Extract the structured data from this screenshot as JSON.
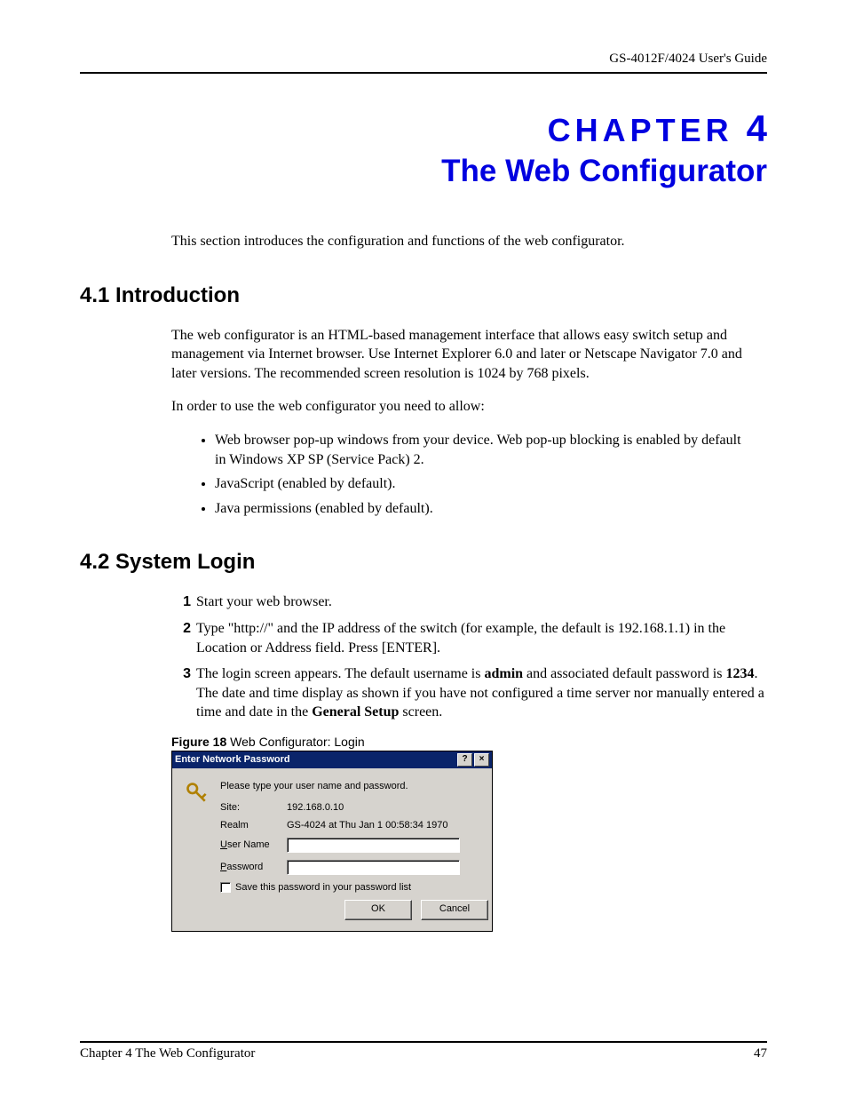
{
  "header": {
    "guide": "GS-4012F/4024 User's Guide"
  },
  "chapter": {
    "label": "CHAPTER",
    "number": "4",
    "title": "The Web Configurator",
    "intro": "This section introduces the configuration and functions of the web configurator."
  },
  "section1": {
    "heading": "4.1  Introduction",
    "para1": "The web configurator is an HTML-based management interface that allows easy switch setup and management via Internet browser. Use Internet Explorer 6.0 and later or Netscape Navigator 7.0 and later versions. The recommended screen resolution is 1024 by 768 pixels.",
    "para2": "In order to use the web configurator you need to allow:",
    "bullets": [
      "Web browser pop-up windows from your device. Web pop-up blocking is enabled by default in Windows XP SP (Service Pack) 2.",
      "JavaScript (enabled by default).",
      "Java permissions (enabled by default)."
    ]
  },
  "section2": {
    "heading": "4.2  System Login",
    "steps": [
      {
        "n": "1",
        "text": "Start your web browser."
      },
      {
        "n": "2",
        "text_before": "Type \"http://\" and the IP address of the switch (for example, the default is 192.168.1.1) in the Location or Address field. Press [ENTER]."
      },
      {
        "n": "3",
        "p1": "The login screen appears. The default username is ",
        "b1": "admin",
        "p2": " and associated default password is ",
        "b2": "1234",
        "p3": ". The date and time display as shown if you have not configured a time server nor manually entered a time and date in the ",
        "b3": "General Setup",
        "p4": " screen."
      }
    ],
    "figure": {
      "label": "Figure 18",
      "caption": "   Web Configurator: Login"
    }
  },
  "dialog": {
    "title": "Enter Network Password",
    "help_btn": "?",
    "close_btn": "×",
    "prompt": "Please type your user name and password.",
    "site_label": "Site:",
    "site_value": "192.168.0.10",
    "realm_label": "Realm",
    "realm_value": "GS-4024 at Thu Jan  1 00:58:34 1970",
    "user_u": "U",
    "user_rest": "ser Name",
    "pass_u": "P",
    "pass_rest": "assword",
    "save_u": "S",
    "save_rest": "ave this password in your password list",
    "ok": "OK",
    "cancel": "Cancel"
  },
  "footer": {
    "left": "Chapter 4 The Web Configurator",
    "right": "47"
  }
}
